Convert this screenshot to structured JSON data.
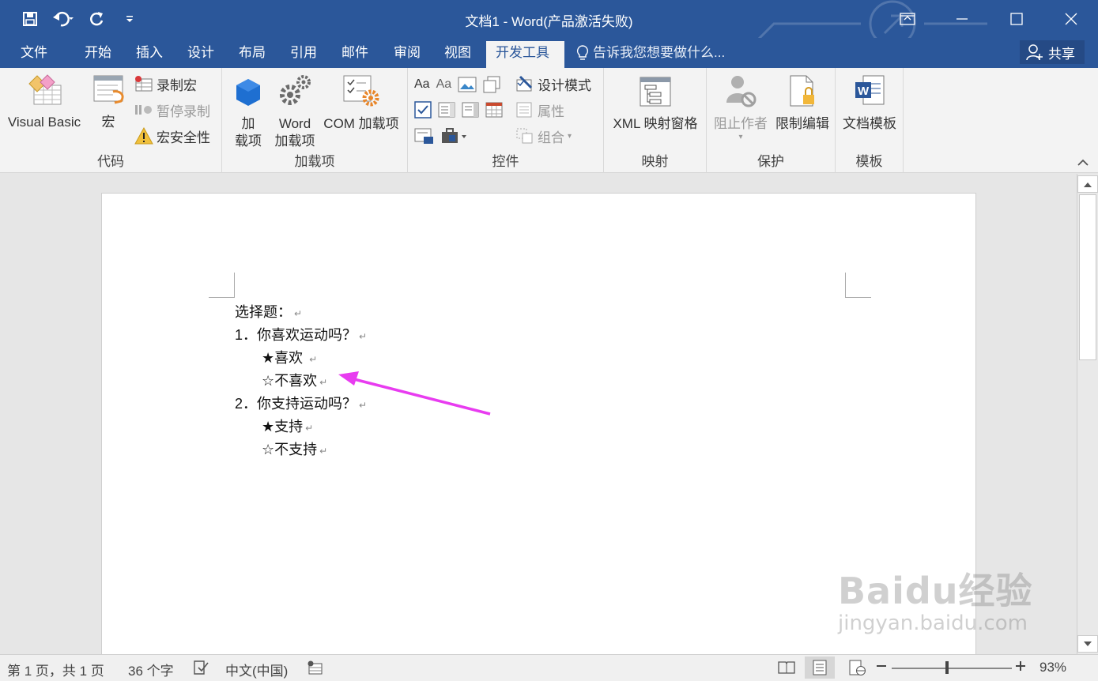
{
  "window": {
    "title": "文档1 - Word(产品激活失败)",
    "controls": [
      "restore-ribbon",
      "minimize",
      "maximize",
      "close"
    ]
  },
  "tabs": [
    "文件",
    "开始",
    "插入",
    "设计",
    "布局",
    "引用",
    "邮件",
    "审阅",
    "视图",
    "开发工具"
  ],
  "active_tab": "开发工具",
  "tell_me": "告诉我您想要做什么...",
  "share_label": "共享",
  "ribbon": {
    "code": {
      "label": "代码",
      "visual_basic": "Visual Basic",
      "macros": "宏",
      "record_macro": "录制宏",
      "pause_recording": "暂停录制",
      "macro_security": "宏安全性"
    },
    "addins": {
      "label": "加载项",
      "addins_line1": "加",
      "addins_line2": "载项",
      "word_addins_line1": "Word",
      "word_addins_line2": "加载项",
      "com_addins": "COM 加载项"
    },
    "controls": {
      "label": "控件",
      "design_mode": "设计模式",
      "properties": "属性",
      "group": "组合"
    },
    "mapping": {
      "label": "映射",
      "xml_pane": "XML 映射窗格"
    },
    "protect": {
      "label": "保护",
      "block_authors": "阻止作者",
      "restrict_editing": "限制编辑"
    },
    "templates": {
      "label": "模板",
      "document_template": "文档模板"
    }
  },
  "document": {
    "lines": [
      "选择题：",
      "1．你喜欢运动吗？",
      "★喜欢 ",
      "☆不喜欢",
      "2．你支持运动吗？",
      "★支持",
      "☆不支持"
    ]
  },
  "status": {
    "page": "第 1 页，共 1 页",
    "words": "36 个字",
    "language": "中文(中国)",
    "zoom": "93%",
    "zoom_level": 0.93
  },
  "watermark": {
    "brand": "Baidu经验",
    "url": "jingyan.baidu.com"
  },
  "colors": {
    "title_bar": "#2b579a",
    "ribbon_bg": "#f3f3f3",
    "annotation_arrow": "#e83cf0"
  }
}
